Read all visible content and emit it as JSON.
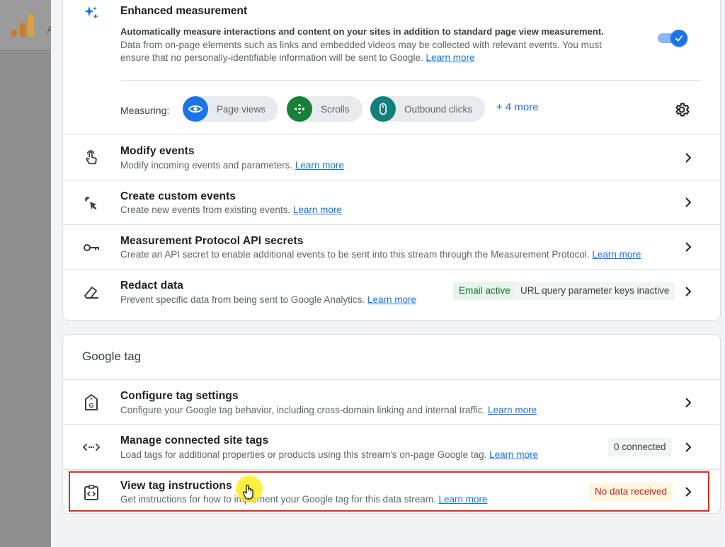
{
  "background": {
    "partial_letter": "A"
  },
  "enhanced": {
    "title": "Enhanced measurement",
    "bold_desc": "Automatically measure interactions and content on your sites in addition to standard page view measurement.",
    "desc": "Data from on-page elements such as links and embedded videos may be collected with relevant events. You must ensure that no personally-identifiable information will be sent to Google. ",
    "learn_more": "Learn more",
    "toggle_on": true,
    "measuring_label": "Measuring:",
    "chips": [
      {
        "label": "Page views",
        "icon": "eye-icon",
        "color": "#1a73e8"
      },
      {
        "label": "Scrolls",
        "icon": "scroll-arrows-icon",
        "color": "#188038"
      },
      {
        "label": "Outbound clicks",
        "icon": "mouse-icon",
        "color": "#12807a"
      }
    ],
    "more": "+ 4 more"
  },
  "rows1": [
    {
      "title": "Modify events",
      "desc": "Modify incoming events and parameters. ",
      "link": "Learn more",
      "icon": "touch-hand-icon"
    },
    {
      "title": "Create custom events",
      "desc": "Create new events from existing events. ",
      "link": "Learn more",
      "icon": "sparkle-cursor-icon"
    },
    {
      "title": "Measurement Protocol API secrets",
      "desc": "Create an API secret to enable additional events to be sent into this stream through the Measurement Protocol. ",
      "link": "Learn more",
      "icon": "key-icon"
    },
    {
      "title": "Redact data",
      "desc": "Prevent specific data from being sent to Google Analytics. ",
      "link": "Learn more",
      "icon": "eraser-icon",
      "badges": [
        "Email active",
        "URL query parameter keys inactive"
      ]
    }
  ],
  "google_tag": {
    "section_title": "Google tag",
    "rows": [
      {
        "title": "Configure tag settings",
        "desc": "Configure your Google tag behavior, including cross-domain linking and internal traffic. ",
        "link": "Learn more",
        "icon": "tag-g-icon"
      },
      {
        "title": "Manage connected site tags",
        "desc": "Load tags for additional properties or products using this stream's on-page Google tag. ",
        "link": "Learn more",
        "icon": "code-arrows-icon",
        "badge": "0 connected"
      },
      {
        "title": "View tag instructions",
        "desc": "Get instructions for how to implement your Google tag for this data stream. ",
        "link": "Learn more",
        "icon": "code-clipboard-icon",
        "badge": "No data received"
      }
    ]
  }
}
